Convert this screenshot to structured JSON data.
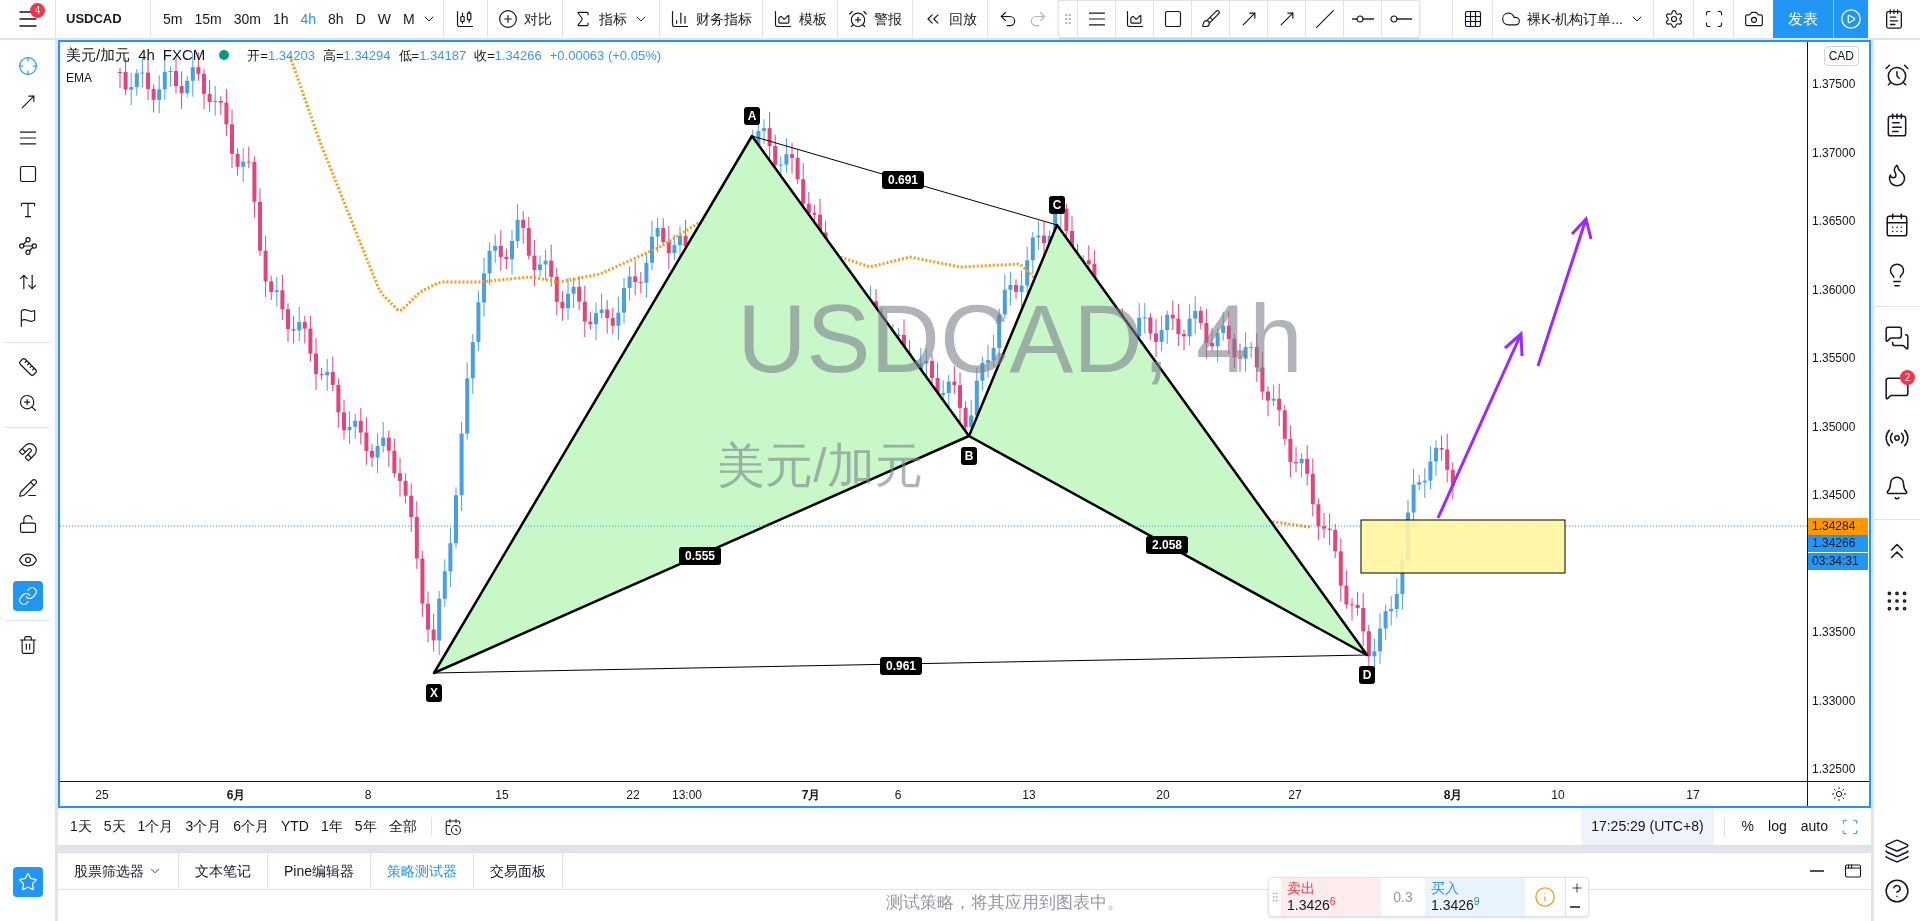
{
  "top_toolbar": {
    "menu_badge": "4",
    "symbol": "USDCAD",
    "intervals": [
      {
        "label": "5m",
        "selected": false
      },
      {
        "label": "15m",
        "selected": false
      },
      {
        "label": "30m",
        "selected": false
      },
      {
        "label": "1h",
        "selected": false
      },
      {
        "label": "4h",
        "selected": true
      },
      {
        "label": "8h",
        "selected": false
      },
      {
        "label": "D",
        "selected": false
      },
      {
        "label": "W",
        "selected": false
      },
      {
        "label": "M",
        "selected": false
      }
    ],
    "buttons": [
      {
        "label": "对比"
      },
      {
        "label": "指标"
      },
      {
        "label": "财务指标"
      },
      {
        "label": "模板"
      },
      {
        "label": "警报"
      },
      {
        "label": "回放"
      }
    ],
    "layout_name": "裸K-机构订单...",
    "publish": "发表"
  },
  "legend": {
    "title": "美元/加元",
    "interval": "4h",
    "source": "FXCM",
    "ohlc": [
      {
        "key": "开=",
        "value": "1.34203"
      },
      {
        "key": "高=",
        "value": "1.34294"
      },
      {
        "key": "低=",
        "value": "1.34187"
      },
      {
        "key": "收=",
        "value": "1.34266"
      }
    ],
    "change": "+0.00063 (+0.05%)",
    "indicator": "EMA"
  },
  "watermark": {
    "symbol": "USDCAD, 4h",
    "name": "美元/加元"
  },
  "pattern": {
    "points": [
      "X",
      "A",
      "B",
      "C",
      "D"
    ],
    "ratios": [
      "0.691",
      "0.555",
      "2.058",
      "0.961"
    ]
  },
  "price_axis": {
    "currency": "CAD",
    "ticks": [
      "1.37500",
      "1.37000",
      "1.36500",
      "1.36000",
      "1.35500",
      "1.35000",
      "1.34500",
      "1.33500",
      "1.33000",
      "1.32500"
    ],
    "tags": [
      {
        "label": "1.34284",
        "color": "#ff9800"
      },
      {
        "label": "1.34266",
        "color": "#2196f3"
      },
      {
        "label": "03:34:31",
        "color": "#2196f3"
      }
    ]
  },
  "time_axis": [
    {
      "label": "25",
      "major": false
    },
    {
      "label": "6月",
      "major": true
    },
    {
      "label": "8",
      "major": false
    },
    {
      "label": "15",
      "major": false
    },
    {
      "label": "22",
      "major": false
    },
    {
      "label": "13:00",
      "major": false
    },
    {
      "label": "7月",
      "major": true
    },
    {
      "label": "6",
      "major": false
    },
    {
      "label": "13",
      "major": false
    },
    {
      "label": "20",
      "major": false
    },
    {
      "label": "27",
      "major": false
    },
    {
      "label": "8月",
      "major": true
    },
    {
      "label": "10",
      "major": false
    },
    {
      "label": "17",
      "major": false
    }
  ],
  "range_bar": {
    "ranges": [
      "1天",
      "5天",
      "1个月",
      "3个月",
      "6个月",
      "YTD",
      "1年",
      "5年",
      "全部"
    ],
    "clock": "17:25:29 (UTC+8)",
    "options": [
      "%",
      "log",
      "auto"
    ]
  },
  "bottom_panel": {
    "tabs": [
      {
        "label": "股票筛选器",
        "selected": false
      },
      {
        "label": "文本笔记",
        "selected": false
      },
      {
        "label": "Pine编辑器",
        "selected": false
      },
      {
        "label": "策略测试器",
        "selected": true
      },
      {
        "label": "交易面板",
        "selected": false
      }
    ],
    "message": "测试策略，将其应用到图表中。"
  },
  "trade_widget": {
    "sell_label": "卖出",
    "sell_price": "1.3426",
    "sell_digit": "6",
    "spread": "0.3",
    "buy_label": "买入",
    "buy_price": "1.3426",
    "buy_digit": "9"
  },
  "right_sidebar": {
    "badge": "2"
  }
}
